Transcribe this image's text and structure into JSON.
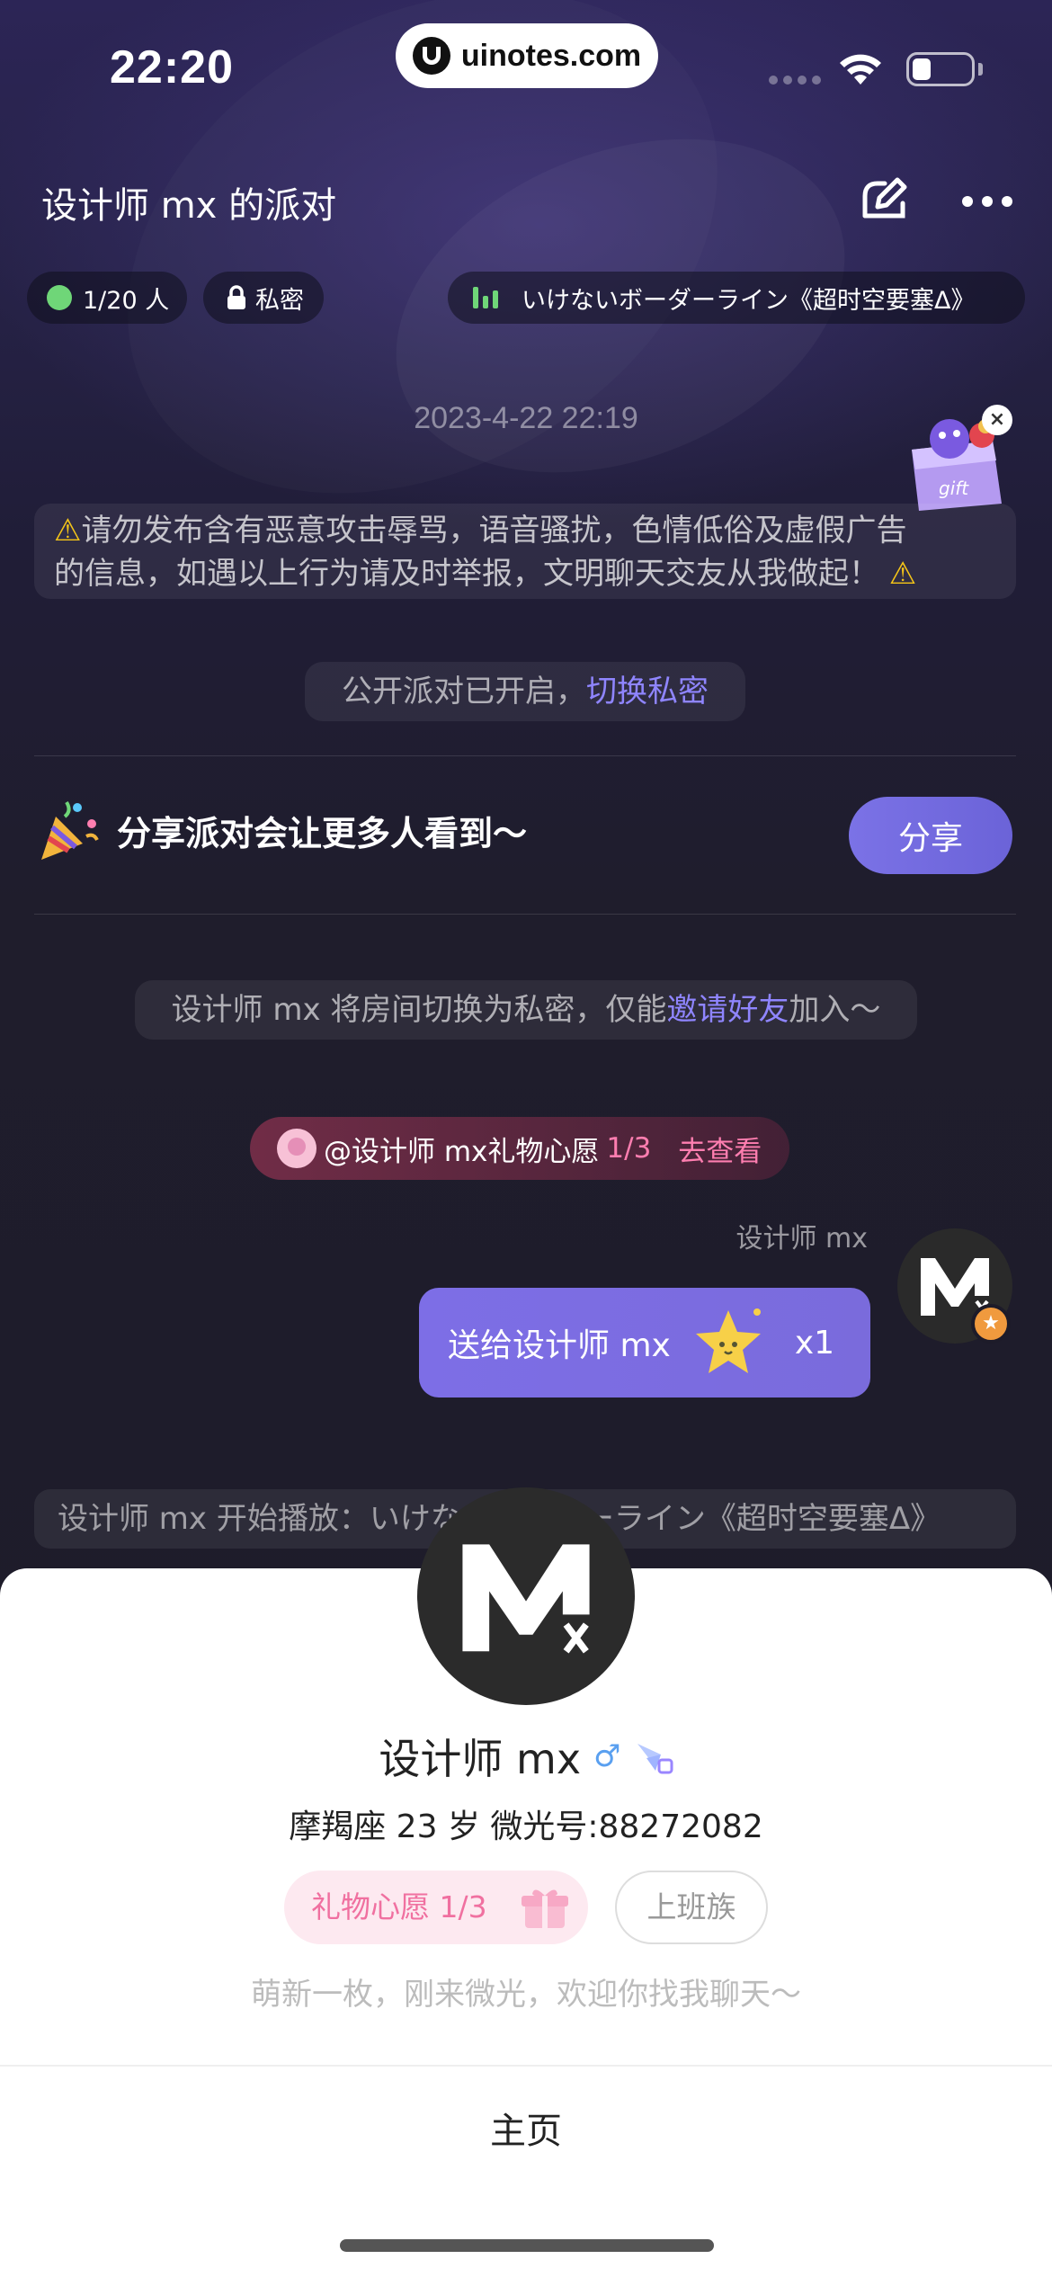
{
  "status_bar": {
    "time": "22:20"
  },
  "watermark": {
    "text": "uinotes.com"
  },
  "header": {
    "room_title": "设计师 mx 的派对"
  },
  "chips": {
    "online": "1/20 人",
    "privacy": "私密",
    "music": "いけないボーダーライン《超时空要塞Δ》"
  },
  "chat": {
    "timestamp": "2023-4-22 22:19",
    "warning": {
      "line1": "请勿发布含有恶意攻击辱骂，语音骚扰，色情低俗及虚假广告",
      "line2": "的信息，如遇以上行为请及时举报，文明聊天交友从我做起！"
    },
    "public_notice": {
      "text": "公开派对已开启，",
      "link": "切换私密"
    },
    "share": {
      "text": "分享派对会让更多人看到～",
      "button": "分享"
    },
    "private_notice": {
      "text_before": "设计师 mx 将房间切换为私密，仅能",
      "link": "邀请好友",
      "text_after": "加入～"
    },
    "wish": {
      "text": "@设计师 mx礼物心愿",
      "count": "1/3",
      "link": "去查看"
    },
    "sender": "设计师 mx",
    "gift_message": {
      "text": "送给设计师 mx",
      "quantity": "x1"
    },
    "play_message": "设计师 mx 开始播放：いけないボーダーライン《超时空要塞Δ》"
  },
  "profile": {
    "name": "设计师 mx",
    "gender_symbol": "♂",
    "info": "摩羯座  23 岁  微光号:88272082",
    "wish_tag": "礼物心愿  1/3",
    "job_tag": "上班族",
    "bio": "萌新一枚，刚来微光，欢迎你找我聊天～",
    "home_button": "主页"
  },
  "colors": {
    "accent": "#8f85ff",
    "share_button": "#7b72e6",
    "online_dot": "#6fd678",
    "pink": "#ff7eb0"
  }
}
